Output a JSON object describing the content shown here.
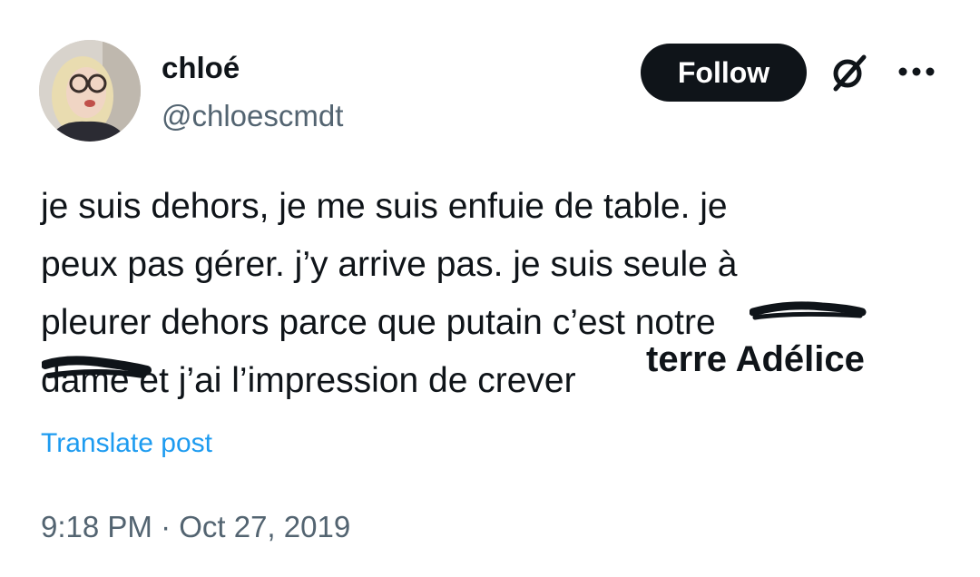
{
  "author": {
    "display_name": "chloé",
    "handle": "@chloescmdt"
  },
  "actions": {
    "follow_label": "Follow",
    "grok_icon": "grok-slash-icon",
    "more_icon": "more-horizontal-icon"
  },
  "post": {
    "lines": [
      "je suis dehors, je me suis enfuie de table. je",
      "peux pas gérer. j’y arrive pas. je suis seule à",
      "pleurer dehors parce que putain c’est notre",
      "dame et j’ai l’impression de crever"
    ],
    "overlay_text": "terre Adélice",
    "translate_label": "Translate post"
  },
  "meta": {
    "timestamp": "9:18 PM · Oct 27, 2019"
  },
  "colors": {
    "text": "#0f1419",
    "secondary": "#536471",
    "link": "#1d9bf0",
    "follow_bg": "#0f1419"
  }
}
